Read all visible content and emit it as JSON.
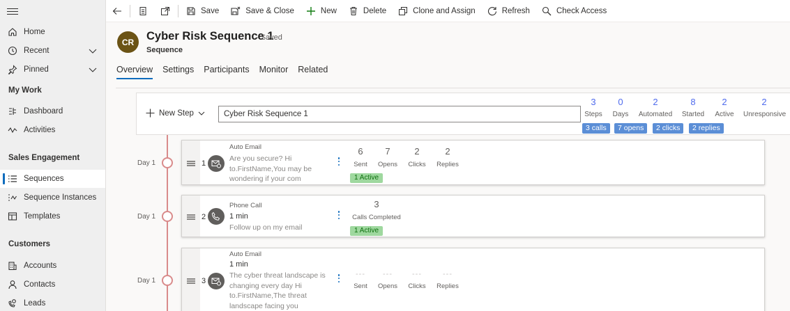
{
  "sidebar": {
    "items": [
      {
        "label": "Home",
        "icon": "home-icon"
      },
      {
        "label": "Recent",
        "icon": "clock-icon"
      },
      {
        "label": "Pinned",
        "icon": "pin-icon"
      },
      {
        "label": "Dashboard",
        "icon": "dashboard-icon"
      },
      {
        "label": "Activities",
        "icon": "activity-icon"
      },
      {
        "label": "Sequences",
        "icon": "list-icon"
      },
      {
        "label": "Sequence Instances",
        "icon": "sequence-instance-icon"
      },
      {
        "label": "Templates",
        "icon": "template-icon"
      },
      {
        "label": "Accounts",
        "icon": "building-icon"
      },
      {
        "label": "Contacts",
        "icon": "person-icon"
      },
      {
        "label": "Leads",
        "icon": "phone-person-icon"
      }
    ],
    "sections": {
      "my_work": "My Work",
      "sales_engagement": "Sales Engagement",
      "customers": "Customers"
    },
    "active_color": "#0f6cbd"
  },
  "toolbar": {
    "save": "Save",
    "save_close": "Save & Close",
    "new": "New",
    "delete": "Delete",
    "clone_assign": "Clone and Assign",
    "refresh": "Refresh",
    "check_access": "Check Access"
  },
  "record": {
    "initials": "CR",
    "title": "Cyber Risk Sequence 1",
    "saved": "- Saved",
    "type": "Sequence",
    "avatar_color": "#6b5315"
  },
  "tabs": [
    "Overview",
    "Settings",
    "Participants",
    "Monitor",
    "Related"
  ],
  "editor": {
    "new_step": "New Step",
    "name_value": "Cyber Risk Sequence 1"
  },
  "stats": [
    {
      "value": "3",
      "label": "Steps"
    },
    {
      "value": "0",
      "label": "Days"
    },
    {
      "value": "2",
      "label": "Automated"
    },
    {
      "value": "8",
      "label": "Started"
    },
    {
      "value": "2",
      "label": "Active"
    },
    {
      "value": "2",
      "label": "Unresponsive"
    }
  ],
  "chips": [
    "3 calls",
    "7 opens",
    "2 clicks",
    "2 replies"
  ],
  "steps": [
    {
      "day": "Day 1",
      "number": "1",
      "type": "Auto Email",
      "desc": "Are you secure? Hi to.FirstName,You may be wondering if your com",
      "metrics": [
        {
          "value": "6",
          "label": "Sent"
        },
        {
          "value": "7",
          "label": "Opens"
        },
        {
          "value": "2",
          "label": "Clicks"
        },
        {
          "value": "2",
          "label": "Replies"
        }
      ],
      "badge": "1 Active"
    },
    {
      "day": "Day 1",
      "number": "2",
      "type": "Phone Call",
      "main": "1 min",
      "desc": "Follow up on my email",
      "metric": {
        "value": "3",
        "label": "Calls Completed"
      },
      "badge": "1 Active"
    },
    {
      "day": "Day 1",
      "number": "3",
      "type": "Auto Email",
      "main": "1 min",
      "desc": "The cyber threat landscape is changing every day Hi to.FirstName,The threat landscape facing you",
      "metrics": [
        {
          "value": "---",
          "label": "Sent"
        },
        {
          "value": "---",
          "label": "Opens"
        },
        {
          "value": "---",
          "label": "Clicks"
        },
        {
          "value": "---",
          "label": "Replies"
        }
      ]
    }
  ]
}
